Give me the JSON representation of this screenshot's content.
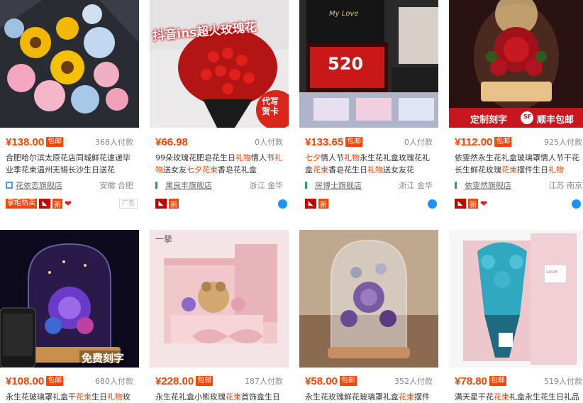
{
  "products": [
    {
      "price": "¥138.00",
      "shipping_tag": "包邮",
      "payers": "368人付款",
      "title_parts": [
        "合肥哈尔滨太原花店同城鲜花速递毕业季花束温州无锡长沙生日送花"
      ],
      "shop": "花依恋旗舰店",
      "location": "安徽 合肥",
      "badges": {
        "hot": "掌柜热卖",
        "new": "新",
        "ad": "广告"
      }
    },
    {
      "price": "¥66.98",
      "shipping_tag": "",
      "payers": "0人付款",
      "title_parts": [
        "99朵玫瑰花肥皂花生日",
        "礼物",
        "情人节",
        "礼物",
        "送女友",
        "七夕花束",
        "香皂花礼盒"
      ],
      "shop": "果良丰旗舰店",
      "location": "浙江 金华",
      "image_text": {
        "top": "抖音ins超火玫瑰花",
        "card": "代写",
        "card2": "贺卡"
      },
      "badges": {
        "new": "新"
      }
    },
    {
      "price": "¥133.65",
      "shipping_tag": "包邮",
      "payers": "0人付款",
      "title_parts": [
        "七夕",
        "情人节",
        "礼物",
        "永生花礼盒玫瑰花礼盒",
        "花束",
        "香皂花生日",
        "礼物",
        "送女友花"
      ],
      "shop": "房博士旗舰店",
      "location": "浙江 金华",
      "image_text": {
        "box": "My Love",
        "num": "520"
      },
      "badges": {
        "new": "新"
      }
    },
    {
      "price": "¥112.00",
      "shipping_tag": "包邮",
      "payers": "925人付款",
      "title_parts": [
        "依雯然永生花礼盒玻璃罩情人节干花长生鲜花玫瑰",
        "花束",
        "摆件生日",
        "礼物"
      ],
      "shop": "依雯然旗舰店",
      "location": "江苏 南京",
      "image_text": {
        "left": "定制刻字",
        "right": "顺丰包邮",
        "sf": "SF"
      },
      "badges": {
        "new": "新"
      }
    },
    {
      "price": "¥108.00",
      "shipping_tag": "包邮",
      "payers": "680人付款",
      "title_parts": [
        "永生花玻璃罩礼盒干",
        "花束",
        "生日",
        "礼物",
        "玫"
      ],
      "image_text": {
        "engrave": "免费刻字"
      }
    },
    {
      "price": "¥228.00",
      "shipping_tag": "包邮",
      "payers": "187人付款",
      "title_parts": [
        "永生花礼盒小熊玫瑰",
        "花束",
        "首饰盒生日"
      ],
      "image_text": {
        "brand": "一挚"
      }
    },
    {
      "price": "¥58.00",
      "shipping_tag": "包邮",
      "payers": "352人付款",
      "title_parts": [
        "永生花玫瑰鲜花玻璃罩礼盒",
        "花束",
        "摆件"
      ]
    },
    {
      "price": "¥78.80",
      "shipping_tag": "包邮",
      "payers": "519人付款",
      "title_parts": [
        "满天星干花",
        "花束",
        "礼盒永生花生日礼品"
      ],
      "image_text": {
        "tag": "Love"
      }
    }
  ],
  "colors": {
    "accent": "#ff4400",
    "tmall": "#c40000"
  }
}
